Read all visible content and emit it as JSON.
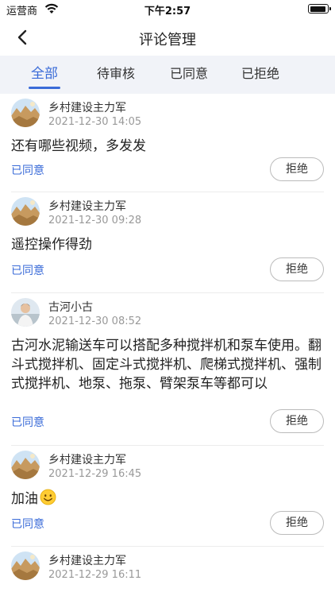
{
  "status_bar": {
    "carrier": "运营商",
    "time": "下午2:57"
  },
  "nav": {
    "title": "评论管理"
  },
  "tabs": [
    {
      "label": "全部",
      "active": true
    },
    {
      "label": "待审核",
      "active": false
    },
    {
      "label": "已同意",
      "active": false
    },
    {
      "label": "已拒绝",
      "active": false
    }
  ],
  "comments": [
    {
      "user": "乡村建设主力军",
      "date": "2021-12-30 14:05",
      "content": "还有哪些视频，多发发",
      "status": "已同意",
      "action": "拒绝",
      "avatar": "landscape-avatar"
    },
    {
      "user": "乡村建设主力军",
      "date": "2021-12-30 09:28",
      "content": "遥控操作得劲",
      "status": "已同意",
      "action": "拒绝",
      "avatar": "landscape-avatar"
    },
    {
      "user": "古河小古",
      "date": "2021-12-30 08:52",
      "content": "古河水泥输送车可以搭配多种搅拌机和泵车使用。翻斗式搅拌机、固定斗式搅拌机、爬梯式搅拌机、强制式搅拌机、地泵、拖泵、臂架泵车等都可以",
      "status": "已同意",
      "action": "拒绝",
      "avatar": "person-avatar"
    },
    {
      "user": "乡村建设主力军",
      "date": "2021-12-29 16:45",
      "content": "加油",
      "status": "已同意",
      "action": "拒绝",
      "avatar": "landscape-avatar",
      "emoji": "smile-emoji"
    },
    {
      "user": "乡村建设主力军",
      "date": "2021-12-29 16:11",
      "content": "",
      "status": "",
      "action": "",
      "avatar": "landscape-avatar"
    }
  ],
  "colors": {
    "accent": "#3a6bd8",
    "tab_bg": "#f1f3f8"
  }
}
